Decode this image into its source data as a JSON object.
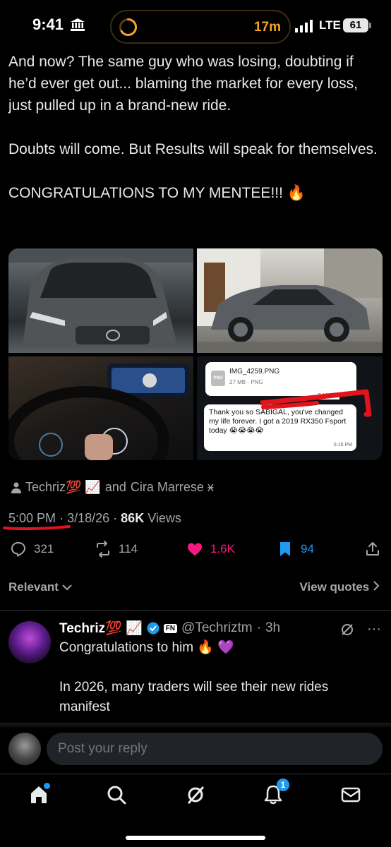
{
  "status": {
    "time": "9:41",
    "timer": "17m",
    "network": "LTE",
    "battery": "61"
  },
  "tweet": {
    "text": "And now? The same guy who was losing, doubting if he’d ever get out... blaming the market for every loss, just pulled up in a brand-new ride.\n\nDoubts will come. But Results will speak for themselves.\n\nCONGRATULATIONS TO MY MENTEE!!! 🔥",
    "media_chat": {
      "file_name": "IMG_4259.PNG",
      "file_meta": "27 MB · PNG",
      "file_type": "PNG",
      "time1": "5:16 PM",
      "message": "Thank you so       SABIGAL, you've changed my life forever. I got a 2019 RX350 Fsport today 😭😭😭😭",
      "time2": "5:16 PM"
    },
    "authors": {
      "first": "Techriz💯 📈",
      "joiner": "and",
      "second": "Cira Marrese ӿ"
    },
    "time": "5:00 PM",
    "date": "3/18/26",
    "views_count": "86K",
    "views_label": "Views",
    "sep": "·",
    "stats": {
      "replies": "321",
      "reposts": "114",
      "likes": "1.6K",
      "bookmarks": "94"
    }
  },
  "sort": {
    "label": "Relevant",
    "view_quotes": "View quotes"
  },
  "reply": {
    "name": "Techriz💯 📈",
    "tag": "FN",
    "handle": "@Techriztm",
    "age": "3h",
    "more": "···",
    "text": "Congratulations to him 🔥 💜\n\nIn 2026, many traders will see their new rides manifest"
  },
  "compose": {
    "placeholder": "Post your reply"
  },
  "tabs": {
    "notifications_badge": "1"
  },
  "colors": {
    "accent": "#1d9bf0",
    "like": "#f91880",
    "timer": "#f5a524"
  }
}
